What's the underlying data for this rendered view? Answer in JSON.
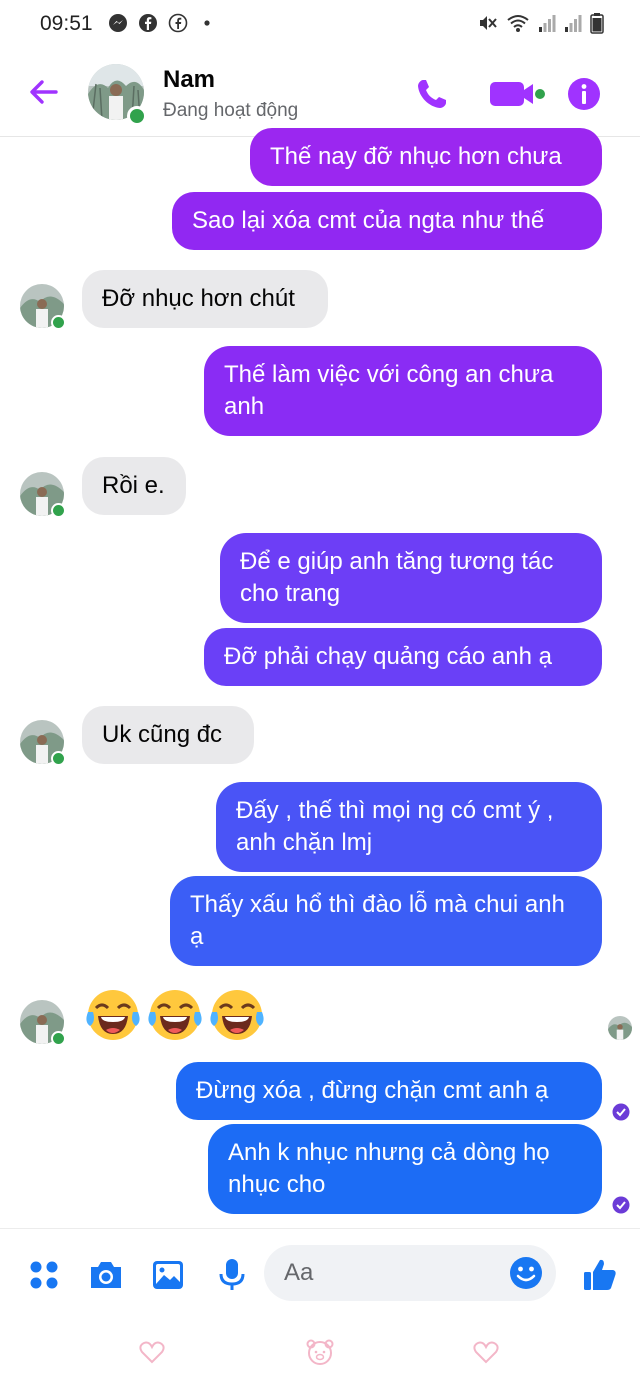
{
  "status_bar": {
    "time": "09:51"
  },
  "header": {
    "name": "Nam",
    "status": "Đang hoạt động"
  },
  "messages": [
    {
      "side": "out",
      "text": "Thế nay đỡ nhục hơn chưa"
    },
    {
      "side": "out",
      "text": "Sao lại xóa cmt của ngta như thế"
    },
    {
      "side": "in",
      "text": "Đỡ nhục hơn chút"
    },
    {
      "side": "out",
      "text": "Thế làm việc với công an chưa anh"
    },
    {
      "side": "in",
      "text": "Rồi e."
    },
    {
      "side": "out",
      "text": "Để e giúp anh tăng tương tác cho trang"
    },
    {
      "side": "out",
      "text": "Đỡ phải chạy quảng cáo anh ạ"
    },
    {
      "side": "in",
      "text": "Uk cũng đc"
    },
    {
      "side": "out",
      "text": "Đấy , thế thì mọi ng có cmt ý , anh chặn lmj"
    },
    {
      "side": "out",
      "text": "Thấy xấu hổ thì đào lỗ mà chui anh ạ"
    },
    {
      "side": "in",
      "text": "😂😂😂"
    },
    {
      "side": "out",
      "text": "Đừng xóa , đừng chặn cmt anh ạ"
    },
    {
      "side": "out",
      "text": "Anh k nhục nhưng cả dòng họ nhục cho"
    }
  ],
  "composer": {
    "placeholder": "Aa"
  },
  "colors": {
    "accent": "#a033ff",
    "bubble_top": "#9b27f0",
    "bubble_mid": "#6b3df7",
    "bubble_bottom": "#1c6cf5",
    "incoming": "#e9e9eb",
    "online": "#31a24c"
  },
  "icons": [
    "back-arrow-icon",
    "phone-icon",
    "video-icon",
    "info-icon",
    "apps-icon",
    "camera-icon",
    "gallery-icon",
    "mic-icon",
    "emoji-icon",
    "like-icon"
  ]
}
